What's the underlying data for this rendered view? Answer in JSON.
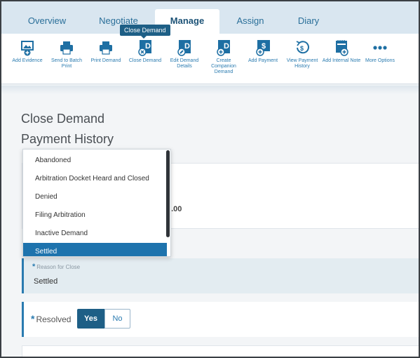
{
  "tabs": [
    {
      "label": "Overview",
      "active": false
    },
    {
      "label": "Negotiate",
      "active": false
    },
    {
      "label": "Manage",
      "active": true
    },
    {
      "label": "Assign",
      "active": false
    },
    {
      "label": "Diary",
      "active": false
    }
  ],
  "toolbar": {
    "tooltip": "Close Demand",
    "tools": [
      {
        "label": "Add Evidence",
        "icon": "add-evidence-icon"
      },
      {
        "label": "Send to Batch Print",
        "icon": "printer-icon"
      },
      {
        "label": "Print Demand",
        "icon": "printer-icon"
      },
      {
        "label": "Close Demand",
        "icon": "close-demand-icon"
      },
      {
        "label": "Edit Demand Details",
        "icon": "edit-demand-icon"
      },
      {
        "label": "Create Companion Demand",
        "icon": "add-demand-icon"
      },
      {
        "label": "Add Payment",
        "icon": "add-payment-icon"
      },
      {
        "label": "View Payment History",
        "icon": "payment-history-icon"
      },
      {
        "label": "Add Internal Note",
        "icon": "add-note-icon"
      },
      {
        "label": "More Options",
        "icon": "more-dots-icon"
      }
    ]
  },
  "page": {
    "title": "Close Demand",
    "subtitle": "Payment History",
    "amount_fragment": "0.00"
  },
  "dropdown": {
    "options": [
      "Abandoned",
      "Arbitration Docket Heard and Closed",
      "Denied",
      "Filing Arbitration",
      "Inactive Demand",
      "Settled"
    ],
    "selected": "Settled"
  },
  "reason": {
    "label": "Reason for Close",
    "required_mark": "*",
    "value": "Settled"
  },
  "resolved": {
    "label": "Resolved",
    "required_mark": "*",
    "yes": "Yes",
    "no": "No",
    "selected": "Yes"
  },
  "colors": {
    "accent": "#1e5f86",
    "link": "#2a7bb0",
    "selected_option": "#1e73ad"
  }
}
